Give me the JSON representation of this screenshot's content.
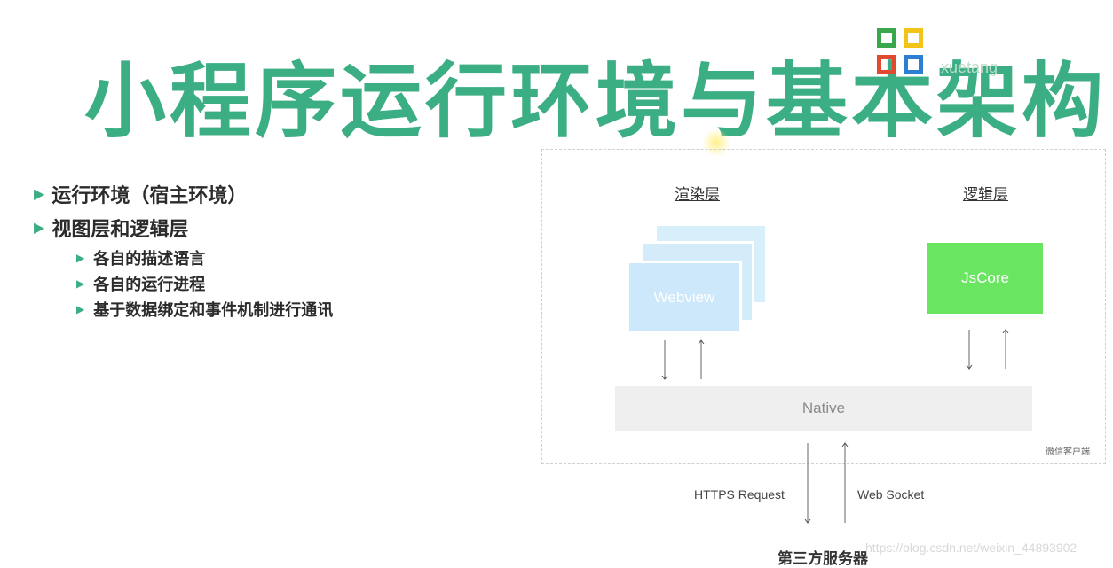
{
  "title": "小程序运行环境与基本架构",
  "logo": {
    "text": "xuetang",
    "icon": "grid-logo-icon"
  },
  "bullets": {
    "level1": [
      "运行环境（宿主环境）",
      "视图层和逻辑层"
    ],
    "level2": [
      "各自的描述语言",
      "各自的运行进程",
      "基于数据绑定和事件机制进行通讯"
    ],
    "marker_icon": "triangle-right-icon"
  },
  "diagram": {
    "render_layer_label": "渲染层",
    "logic_layer_label": "逻辑层",
    "webview_label": "Webview",
    "jscore_label": "JsCore",
    "native_label": "Native",
    "client_label": "微信客户端",
    "https_label": "HTTPS Request",
    "websocket_label": "Web Socket",
    "server_label": "第三方服务器"
  },
  "watermark": "https://blog.csdn.net/weixin_44893902",
  "colors": {
    "title_green": "#3cae84",
    "webview_blue": "#cde8fa",
    "jscore_green": "#6ae561",
    "native_gray": "#efefef"
  }
}
